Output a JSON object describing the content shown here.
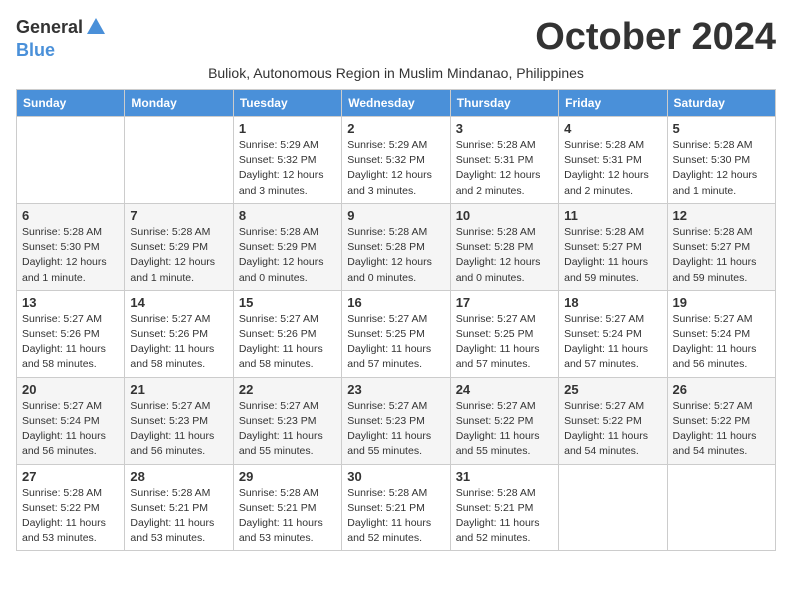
{
  "logo": {
    "general": "General",
    "blue": "Blue"
  },
  "title": "October 2024",
  "subtitle": "Buliok, Autonomous Region in Muslim Mindanao, Philippines",
  "headers": [
    "Sunday",
    "Monday",
    "Tuesday",
    "Wednesday",
    "Thursday",
    "Friday",
    "Saturday"
  ],
  "weeks": [
    [
      {
        "day": "",
        "info": ""
      },
      {
        "day": "",
        "info": ""
      },
      {
        "day": "1",
        "info": "Sunrise: 5:29 AM\nSunset: 5:32 PM\nDaylight: 12 hours and 3 minutes."
      },
      {
        "day": "2",
        "info": "Sunrise: 5:29 AM\nSunset: 5:32 PM\nDaylight: 12 hours and 3 minutes."
      },
      {
        "day": "3",
        "info": "Sunrise: 5:28 AM\nSunset: 5:31 PM\nDaylight: 12 hours and 2 minutes."
      },
      {
        "day": "4",
        "info": "Sunrise: 5:28 AM\nSunset: 5:31 PM\nDaylight: 12 hours and 2 minutes."
      },
      {
        "day": "5",
        "info": "Sunrise: 5:28 AM\nSunset: 5:30 PM\nDaylight: 12 hours and 1 minute."
      }
    ],
    [
      {
        "day": "6",
        "info": "Sunrise: 5:28 AM\nSunset: 5:30 PM\nDaylight: 12 hours and 1 minute."
      },
      {
        "day": "7",
        "info": "Sunrise: 5:28 AM\nSunset: 5:29 PM\nDaylight: 12 hours and 1 minute."
      },
      {
        "day": "8",
        "info": "Sunrise: 5:28 AM\nSunset: 5:29 PM\nDaylight: 12 hours and 0 minutes."
      },
      {
        "day": "9",
        "info": "Sunrise: 5:28 AM\nSunset: 5:28 PM\nDaylight: 12 hours and 0 minutes."
      },
      {
        "day": "10",
        "info": "Sunrise: 5:28 AM\nSunset: 5:28 PM\nDaylight: 12 hours and 0 minutes."
      },
      {
        "day": "11",
        "info": "Sunrise: 5:28 AM\nSunset: 5:27 PM\nDaylight: 11 hours and 59 minutes."
      },
      {
        "day": "12",
        "info": "Sunrise: 5:28 AM\nSunset: 5:27 PM\nDaylight: 11 hours and 59 minutes."
      }
    ],
    [
      {
        "day": "13",
        "info": "Sunrise: 5:27 AM\nSunset: 5:26 PM\nDaylight: 11 hours and 58 minutes."
      },
      {
        "day": "14",
        "info": "Sunrise: 5:27 AM\nSunset: 5:26 PM\nDaylight: 11 hours and 58 minutes."
      },
      {
        "day": "15",
        "info": "Sunrise: 5:27 AM\nSunset: 5:26 PM\nDaylight: 11 hours and 58 minutes."
      },
      {
        "day": "16",
        "info": "Sunrise: 5:27 AM\nSunset: 5:25 PM\nDaylight: 11 hours and 57 minutes."
      },
      {
        "day": "17",
        "info": "Sunrise: 5:27 AM\nSunset: 5:25 PM\nDaylight: 11 hours and 57 minutes."
      },
      {
        "day": "18",
        "info": "Sunrise: 5:27 AM\nSunset: 5:24 PM\nDaylight: 11 hours and 57 minutes."
      },
      {
        "day": "19",
        "info": "Sunrise: 5:27 AM\nSunset: 5:24 PM\nDaylight: 11 hours and 56 minutes."
      }
    ],
    [
      {
        "day": "20",
        "info": "Sunrise: 5:27 AM\nSunset: 5:24 PM\nDaylight: 11 hours and 56 minutes."
      },
      {
        "day": "21",
        "info": "Sunrise: 5:27 AM\nSunset: 5:23 PM\nDaylight: 11 hours and 56 minutes."
      },
      {
        "day": "22",
        "info": "Sunrise: 5:27 AM\nSunset: 5:23 PM\nDaylight: 11 hours and 55 minutes."
      },
      {
        "day": "23",
        "info": "Sunrise: 5:27 AM\nSunset: 5:23 PM\nDaylight: 11 hours and 55 minutes."
      },
      {
        "day": "24",
        "info": "Sunrise: 5:27 AM\nSunset: 5:22 PM\nDaylight: 11 hours and 55 minutes."
      },
      {
        "day": "25",
        "info": "Sunrise: 5:27 AM\nSunset: 5:22 PM\nDaylight: 11 hours and 54 minutes."
      },
      {
        "day": "26",
        "info": "Sunrise: 5:27 AM\nSunset: 5:22 PM\nDaylight: 11 hours and 54 minutes."
      }
    ],
    [
      {
        "day": "27",
        "info": "Sunrise: 5:28 AM\nSunset: 5:22 PM\nDaylight: 11 hours and 53 minutes."
      },
      {
        "day": "28",
        "info": "Sunrise: 5:28 AM\nSunset: 5:21 PM\nDaylight: 11 hours and 53 minutes."
      },
      {
        "day": "29",
        "info": "Sunrise: 5:28 AM\nSunset: 5:21 PM\nDaylight: 11 hours and 53 minutes."
      },
      {
        "day": "30",
        "info": "Sunrise: 5:28 AM\nSunset: 5:21 PM\nDaylight: 11 hours and 52 minutes."
      },
      {
        "day": "31",
        "info": "Sunrise: 5:28 AM\nSunset: 5:21 PM\nDaylight: 11 hours and 52 minutes."
      },
      {
        "day": "",
        "info": ""
      },
      {
        "day": "",
        "info": ""
      }
    ]
  ]
}
